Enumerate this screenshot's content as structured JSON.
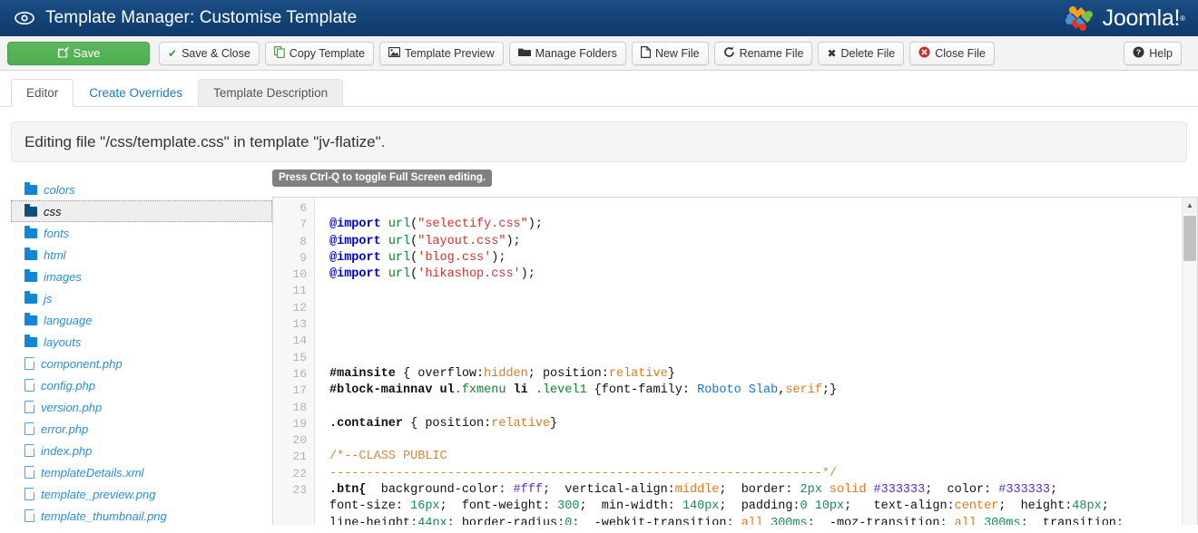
{
  "header": {
    "icon": "eye-icon",
    "title": "Template Manager: Customise Template",
    "brand": "Joomla!",
    "brand_reg": "®",
    "bg_color": "#16487e"
  },
  "toolbar": {
    "buttons": [
      {
        "label": "Save",
        "icon": "pencil-square-icon",
        "style": "primary",
        "accent": "#56b356"
      },
      {
        "label": "Save & Close",
        "icon": "check-icon",
        "style": "default"
      },
      {
        "label": "Copy Template",
        "icon": "copy-icon",
        "style": "default"
      },
      {
        "label": "Template Preview",
        "icon": "picture-icon",
        "style": "default"
      },
      {
        "label": "Manage Folders",
        "icon": "folder-open-icon",
        "style": "default"
      },
      {
        "label": "New File",
        "icon": "file-icon",
        "style": "default"
      },
      {
        "label": "Rename File",
        "icon": "refresh-icon",
        "style": "default"
      },
      {
        "label": "Delete File",
        "icon": "x-icon",
        "style": "default"
      },
      {
        "label": "Close File",
        "icon": "remove-circle-icon",
        "style": "default"
      }
    ],
    "help": {
      "label": "Help",
      "icon": "question-circle-icon"
    }
  },
  "tabs": [
    {
      "label": "Editor",
      "state": "active"
    },
    {
      "label": "Create Overrides",
      "state": "link"
    },
    {
      "label": "Template Description",
      "state": "inactive"
    }
  ],
  "editing_notice": "Editing file \"/css/template.css\" in template \"jv-flatize\".",
  "filetree": [
    {
      "name": "colors",
      "type": "folder",
      "selected": false
    },
    {
      "name": "css",
      "type": "folder",
      "selected": true
    },
    {
      "name": "fonts",
      "type": "folder",
      "selected": false
    },
    {
      "name": "html",
      "type": "folder",
      "selected": false
    },
    {
      "name": "images",
      "type": "folder",
      "selected": false
    },
    {
      "name": "js",
      "type": "folder",
      "selected": false
    },
    {
      "name": "language",
      "type": "folder",
      "selected": false
    },
    {
      "name": "layouts",
      "type": "folder",
      "selected": false
    },
    {
      "name": "component.php",
      "type": "file",
      "selected": false
    },
    {
      "name": "config.php",
      "type": "file",
      "selected": false
    },
    {
      "name": "version.php",
      "type": "file",
      "selected": false
    },
    {
      "name": "error.php",
      "type": "file",
      "selected": false
    },
    {
      "name": "index.php",
      "type": "file",
      "selected": false
    },
    {
      "name": "templateDetails.xml",
      "type": "file",
      "selected": false
    },
    {
      "name": "template_preview.png",
      "type": "file",
      "selected": false
    },
    {
      "name": "template_thumbnail.png",
      "type": "file",
      "selected": false
    }
  ],
  "editor": {
    "tooltip": "Press Ctrl-Q to toggle Full Screen editing.",
    "line_numbers": [
      "6",
      "7",
      "8",
      "9",
      "10",
      "11",
      "12",
      "13",
      "14",
      "15",
      "16",
      "17",
      "18",
      "19",
      "20",
      "21",
      "22",
      "23",
      "",
      ""
    ],
    "scrollbar": {
      "up_arrow": "▲"
    },
    "lines": [
      {
        "n": "6",
        "tokens": []
      },
      {
        "n": "7",
        "tokens": [
          {
            "t": "@import ",
            "c": "t-at"
          },
          {
            "t": "url",
            "c": "t-fn"
          },
          {
            "t": "(",
            "c": "t-punc"
          },
          {
            "t": "\"selectify.css\"",
            "c": "t-str"
          },
          {
            "t": ");",
            "c": "t-punc"
          }
        ]
      },
      {
        "n": "8",
        "tokens": [
          {
            "t": "@import ",
            "c": "t-at"
          },
          {
            "t": "url",
            "c": "t-fn"
          },
          {
            "t": "(",
            "c": "t-punc"
          },
          {
            "t": "\"layout.css\"",
            "c": "t-str"
          },
          {
            "t": ");",
            "c": "t-punc"
          }
        ]
      },
      {
        "n": "9",
        "tokens": [
          {
            "t": "@import ",
            "c": "t-at"
          },
          {
            "t": "url",
            "c": "t-fn"
          },
          {
            "t": "(",
            "c": "t-punc"
          },
          {
            "t": "'blog.css'",
            "c": "t-str"
          },
          {
            "t": ");",
            "c": "t-punc"
          }
        ]
      },
      {
        "n": "10",
        "tokens": [
          {
            "t": "@import ",
            "c": "t-at"
          },
          {
            "t": "url",
            "c": "t-fn"
          },
          {
            "t": "(",
            "c": "t-punc"
          },
          {
            "t": "'hikashop.css'",
            "c": "t-str"
          },
          {
            "t": ");",
            "c": "t-punc"
          }
        ]
      },
      {
        "n": "11",
        "tokens": []
      },
      {
        "n": "12",
        "tokens": []
      },
      {
        "n": "13",
        "tokens": []
      },
      {
        "n": "14",
        "tokens": []
      },
      {
        "n": "15",
        "tokens": []
      },
      {
        "n": "16",
        "tokens": [
          {
            "t": "#mainsite",
            "c": "t-sel"
          },
          {
            "t": " { overflow:",
            "c": "t-prop"
          },
          {
            "t": "hidden",
            "c": "t-val"
          },
          {
            "t": "; position:",
            "c": "t-prop"
          },
          {
            "t": "relative",
            "c": "t-val"
          },
          {
            "t": "}",
            "c": "t-punc"
          }
        ]
      },
      {
        "n": "17",
        "tokens": [
          {
            "t": "#block-mainnav ",
            "c": "t-sel"
          },
          {
            "t": "ul",
            "c": "t-sel"
          },
          {
            "t": ".fxmenu ",
            "c": "t-fn"
          },
          {
            "t": "li",
            "c": "t-sel"
          },
          {
            "t": " .level1 ",
            "c": "t-fn"
          },
          {
            "t": "{font-family: ",
            "c": "t-prop"
          },
          {
            "t": "Roboto Slab",
            "c": "t-id"
          },
          {
            "t": ",",
            "c": "t-punc"
          },
          {
            "t": "serif",
            "c": "t-val"
          },
          {
            "t": ";}",
            "c": "t-punc"
          }
        ]
      },
      {
        "n": "18",
        "tokens": []
      },
      {
        "n": "19",
        "tokens": [
          {
            "t": ".container",
            "c": "t-sel"
          },
          {
            "t": " { position:",
            "c": "t-prop"
          },
          {
            "t": "relative",
            "c": "t-val"
          },
          {
            "t": "}",
            "c": "t-punc"
          }
        ]
      },
      {
        "n": "20",
        "tokens": []
      },
      {
        "n": "21",
        "tokens": [
          {
            "t": "/*--CLASS PUBLIC",
            "c": "t-cmt"
          }
        ]
      },
      {
        "n": "22",
        "tokens": [
          {
            "t": "-------------------------------------------------------------------*/",
            "c": "t-cmt"
          }
        ]
      },
      {
        "n": "23",
        "tokens": [
          {
            "t": ".btn{",
            "c": "t-sel"
          },
          {
            "t": "  background-color: ",
            "c": "t-prop"
          },
          {
            "t": "#fff",
            "c": "t-hex"
          },
          {
            "t": ";  vertical-align:",
            "c": "t-prop"
          },
          {
            "t": "middle",
            "c": "t-val"
          },
          {
            "t": ";  border: ",
            "c": "t-prop"
          },
          {
            "t": "2px ",
            "c": "t-num"
          },
          {
            "t": "solid ",
            "c": "t-val"
          },
          {
            "t": "#333333",
            "c": "t-hex"
          },
          {
            "t": ";  color: ",
            "c": "t-prop"
          },
          {
            "t": "#333333",
            "c": "t-hex"
          },
          {
            "t": ";",
            "c": "t-punc"
          }
        ]
      },
      {
        "n": "",
        "tokens": [
          {
            "t": "font-size: ",
            "c": "t-prop"
          },
          {
            "t": "16px",
            "c": "t-num"
          },
          {
            "t": ";  font-weight: ",
            "c": "t-prop"
          },
          {
            "t": "300",
            "c": "t-num"
          },
          {
            "t": ";  min-width: ",
            "c": "t-prop"
          },
          {
            "t": "140px",
            "c": "t-num"
          },
          {
            "t": ";  padding:",
            "c": "t-prop"
          },
          {
            "t": "0 10px",
            "c": "t-num"
          },
          {
            "t": ";   text-align:",
            "c": "t-prop"
          },
          {
            "t": "center",
            "c": "t-val"
          },
          {
            "t": ";  height:",
            "c": "t-prop"
          },
          {
            "t": "48px",
            "c": "t-num"
          },
          {
            "t": ";",
            "c": "t-punc"
          }
        ]
      },
      {
        "n": "",
        "tokens": [
          {
            "t": "line-height:",
            "c": "t-prop"
          },
          {
            "t": "44px",
            "c": "t-num"
          },
          {
            "t": "; border-radius:",
            "c": "t-prop"
          },
          {
            "t": "0",
            "c": "t-num"
          },
          {
            "t": ";  -webkit-transition: ",
            "c": "t-prop"
          },
          {
            "t": "all ",
            "c": "t-val"
          },
          {
            "t": "300ms",
            "c": "t-num"
          },
          {
            "t": ";  -moz-transition: ",
            "c": "t-prop"
          },
          {
            "t": "all ",
            "c": "t-val"
          },
          {
            "t": "300ms",
            "c": "t-num"
          },
          {
            "t": ";  transition:",
            "c": "t-punc"
          }
        ]
      }
    ]
  }
}
